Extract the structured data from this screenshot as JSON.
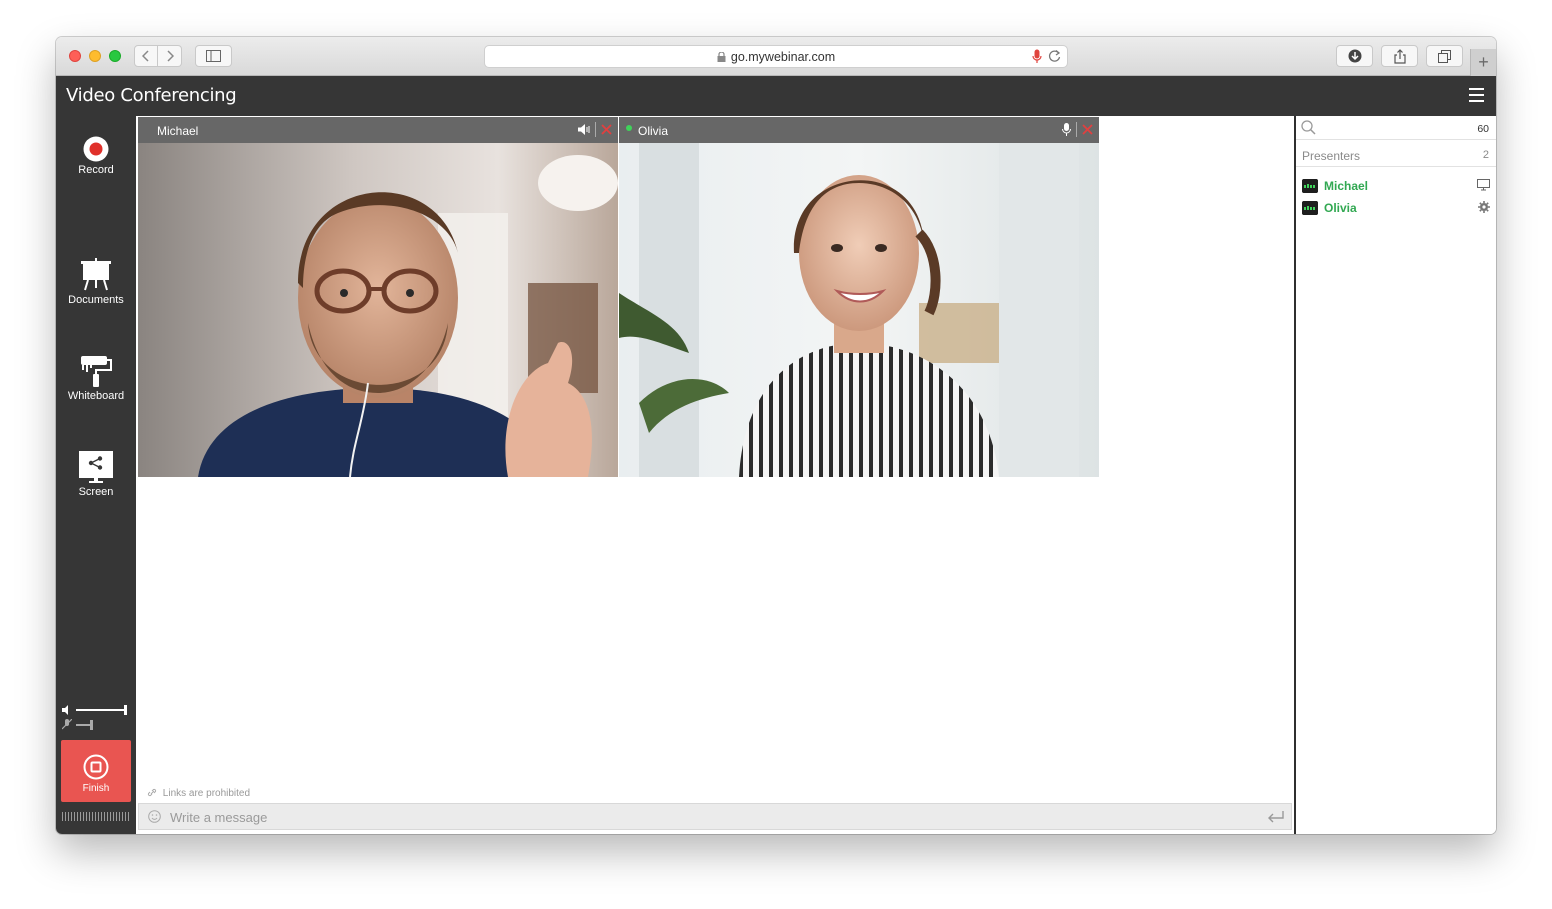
{
  "browser": {
    "url": "go.mywebinar.com",
    "new_tab": "+"
  },
  "app": {
    "title": "Video Conferencing"
  },
  "sidebar": {
    "tools": [
      {
        "label": "Record",
        "icon": "record-icon"
      },
      {
        "label": "Documents",
        "icon": "presentation-board-icon"
      },
      {
        "label": "Whiteboard",
        "icon": "paint-roller-icon"
      },
      {
        "label": "Screen",
        "icon": "screen-share-icon"
      }
    ],
    "finish_label": "Finish"
  },
  "videos": [
    {
      "name": "Michael",
      "audio_icon": "speaker-icon",
      "close_icon": "close-icon"
    },
    {
      "name": "Olivia",
      "audio_icon": "microphone-icon",
      "close_icon": "close-icon"
    }
  ],
  "chat": {
    "note": "Links are prohibited",
    "placeholder": "Write a message"
  },
  "right_panel": {
    "participant_count": "60",
    "presenters_label": "Presenters",
    "presenters_count": "2",
    "users": [
      {
        "name": "Michael",
        "icon": "monitor-icon"
      },
      {
        "name": "Olivia",
        "icon": "gear-icon"
      }
    ]
  },
  "colors": {
    "app_dark": "#363636",
    "finish_red": "#e95551",
    "presenter_green": "#32a852",
    "close_red": "#e04040"
  }
}
